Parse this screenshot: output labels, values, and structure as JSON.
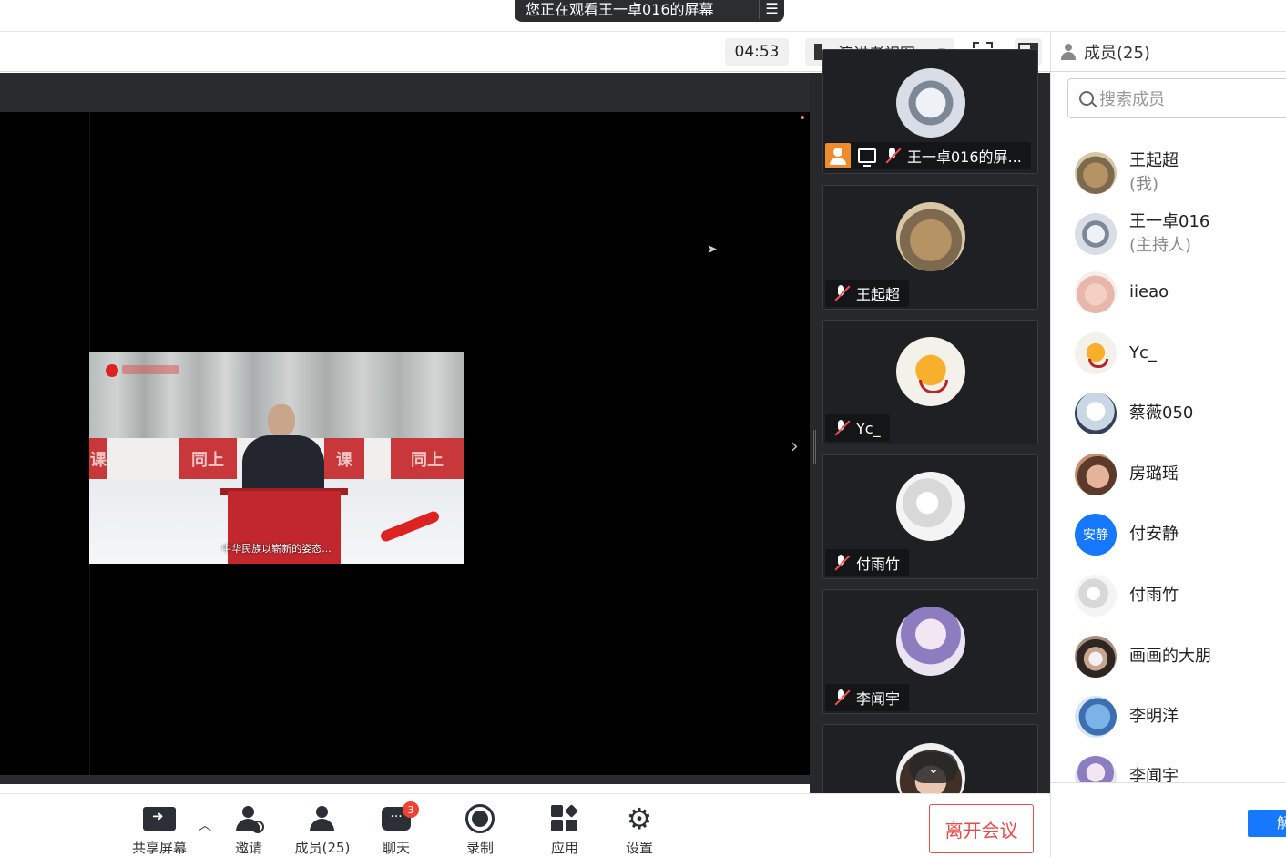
{
  "notice": {
    "text": "您正在观看王一卓016的屏幕",
    "menu_icon": "list-icon"
  },
  "toolbar": {
    "timer": "04:53",
    "view_mode": "演讲者视图",
    "fullscreen_icon": "fullscreen-icon",
    "panel_toggle_icon": "panel-toggle-icon"
  },
  "members_header": {
    "title": "成员(25)"
  },
  "shared_screen": {
    "banner_texts": [
      "课",
      "同上",
      "课",
      "同上"
    ],
    "caption": "中华民族以崭新的姿态..."
  },
  "tiles": [
    {
      "name": "王一卓016的屏...",
      "avatar": "robot-avatar",
      "host": true,
      "sharing": true
    },
    {
      "name": "王起超",
      "avatar": "cat-avatar"
    },
    {
      "name": "Yc_",
      "avatar": "smiley-avatar"
    },
    {
      "name": "付雨竹",
      "avatar": "paper-avatar"
    },
    {
      "name": "李闻宇",
      "avatar": "anime-avatar"
    }
  ],
  "bottom": {
    "share": "共享屏幕",
    "invite": "邀请",
    "members": "成员(25)",
    "chat": "聊天",
    "chat_badge": "3",
    "record": "录制",
    "apps": "应用",
    "settings": "设置",
    "leave": "离开会议"
  },
  "members_panel": {
    "search_placeholder": "搜索成员",
    "members": [
      {
        "name": "王起超",
        "role": "(我)"
      },
      {
        "name": "王一卓016",
        "role": "(主持人)"
      },
      {
        "name": "iieao",
        "role": ""
      },
      {
        "name": "Yc_",
        "role": ""
      },
      {
        "name": "蔡薇050",
        "role": ""
      },
      {
        "name": "房璐瑶",
        "role": ""
      },
      {
        "name": "付安静",
        "role": "",
        "avatar_text": "安静"
      },
      {
        "name": "付雨竹",
        "role": ""
      },
      {
        "name": "画画的大朋",
        "role": ""
      },
      {
        "name": "李明洋",
        "role": ""
      },
      {
        "name": "李闻宇",
        "role": ""
      }
    ],
    "bottom_button": "解"
  },
  "colors": {
    "accent_blue": "#1677ff",
    "leave_red": "#e34d4d",
    "host_orange": "#ef8b2c",
    "mic_muted_red": "#ff4d4f"
  }
}
